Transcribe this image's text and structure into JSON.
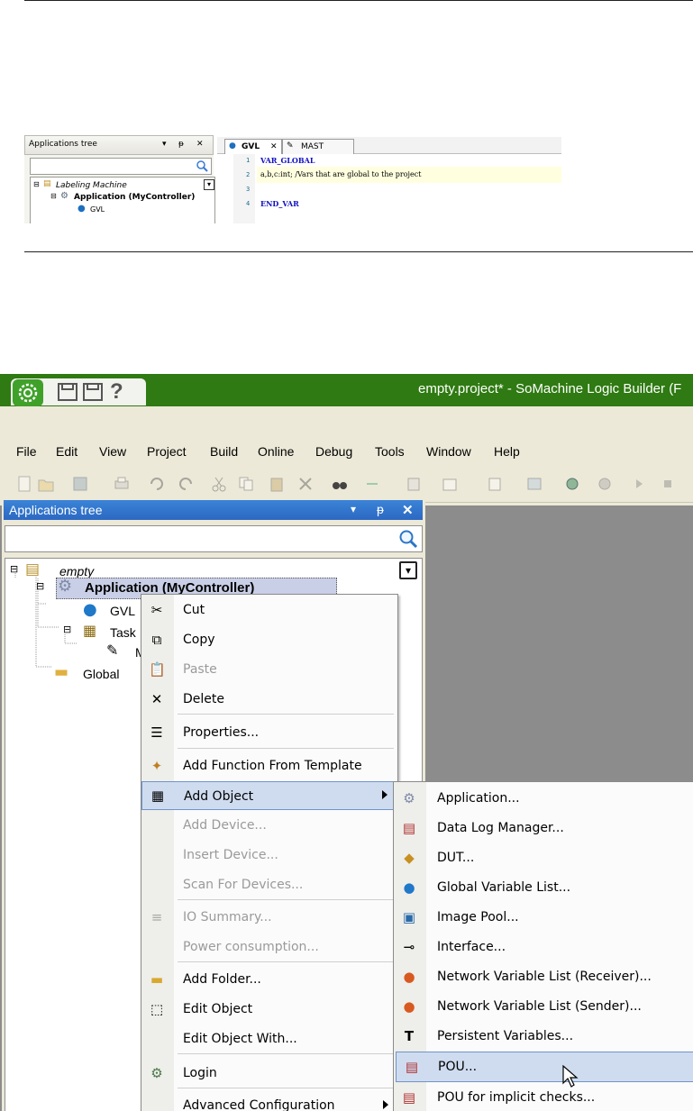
{
  "snapshot1": {
    "tree_title": "Applications tree",
    "tree_items": [
      "Labeling Machine",
      "Application (MyController)",
      "GVL"
    ],
    "tabs": [
      "GVL",
      "MAST"
    ],
    "line_numbers": [
      "1",
      "2",
      "3",
      "4"
    ],
    "code_lines": [
      "VAR_GLOBAL",
      "a,b,c:int; /Vars that are global to the project",
      "",
      "END_VAR"
    ]
  },
  "window": {
    "title": "empty.project* - SoMachine Logic Builder (F",
    "quick_access_help": "?"
  },
  "menu": [
    "File",
    "Edit",
    "View",
    "Project",
    "Build",
    "Online",
    "Debug",
    "Tools",
    "Window",
    "Help"
  ],
  "tree": {
    "title": "Applications tree",
    "items": [
      {
        "label": "empty"
      },
      {
        "label": "Application (MyController)"
      },
      {
        "label": "GVL"
      },
      {
        "label": "Task"
      },
      {
        "label": "M"
      },
      {
        "label": "Global"
      }
    ]
  },
  "context_menu": {
    "items": [
      {
        "label": "Cut",
        "icon": "scissors-icon",
        "enabled": true
      },
      {
        "label": "Copy",
        "icon": "copy-icon",
        "enabled": true
      },
      {
        "label": "Paste",
        "icon": "paste-icon",
        "enabled": false
      },
      {
        "label": "Delete",
        "icon": "delete-icon",
        "enabled": true
      },
      {
        "label": "Properties...",
        "icon": "properties-icon",
        "enabled": true
      },
      {
        "label": "Add Function From Template",
        "icon": "template-icon",
        "enabled": true
      },
      {
        "label": "Add Object",
        "icon": "add-object-icon",
        "enabled": true,
        "submenu": true,
        "highlighted": true
      },
      {
        "label": "Add Device...",
        "enabled": false
      },
      {
        "label": "Insert Device...",
        "enabled": false
      },
      {
        "label": "Scan For Devices...",
        "enabled": false
      },
      {
        "label": "IO Summary...",
        "icon": "io-summary-icon",
        "enabled": false
      },
      {
        "label": "Power consumption...",
        "enabled": false
      },
      {
        "label": "Add Folder...",
        "icon": "folder-icon",
        "enabled": true
      },
      {
        "label": "Edit Object",
        "icon": "edit-object-icon",
        "enabled": true
      },
      {
        "label": "Edit Object With...",
        "enabled": true
      },
      {
        "label": "Login",
        "icon": "login-icon",
        "enabled": true
      },
      {
        "label": "Advanced Configuration",
        "enabled": true,
        "submenu": true
      }
    ]
  },
  "submenu": {
    "items": [
      {
        "label": "Application...",
        "icon": "gear-icon"
      },
      {
        "label": "Data Log Manager...",
        "icon": "datalog-icon"
      },
      {
        "label": "DUT...",
        "icon": "dut-icon"
      },
      {
        "label": "Global Variable List...",
        "icon": "globe-icon"
      },
      {
        "label": "Image Pool...",
        "icon": "image-pool-icon"
      },
      {
        "label": "Interface...",
        "icon": "interface-icon"
      },
      {
        "label": "Network Variable List (Receiver)...",
        "icon": "network-globe-icon"
      },
      {
        "label": "Network Variable List (Sender)...",
        "icon": "network-globe-icon"
      },
      {
        "label": "Persistent Variables...",
        "icon": "persistent-icon"
      },
      {
        "label": "POU...",
        "icon": "pou-icon",
        "highlighted": true
      },
      {
        "label": "POU for implicit checks...",
        "icon": "pou-icon"
      }
    ]
  },
  "colors": {
    "title_green": "#2f7a12",
    "panel_blue": "#2c68c2",
    "highlight": "#cfdcf0"
  }
}
